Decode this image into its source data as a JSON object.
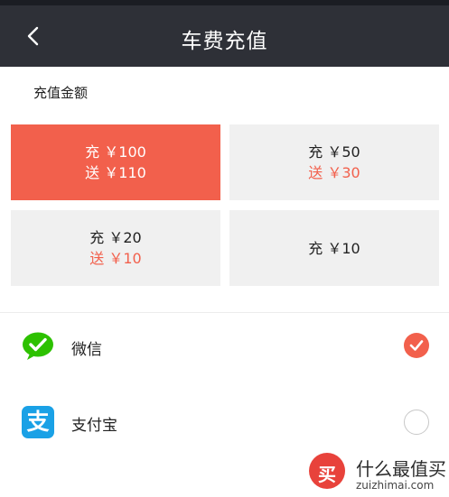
{
  "header": {
    "title": "车费充值",
    "back_icon": "chevron-left-icon"
  },
  "amount_section": {
    "label": "充值金额",
    "options": [
      {
        "charge": "充 ￥100",
        "bonus": "送 ￥110",
        "selected": true
      },
      {
        "charge": "充 ￥50",
        "bonus": "送 ￥30",
        "selected": false
      },
      {
        "charge": "充 ￥20",
        "bonus": "送 ￥10",
        "selected": false
      },
      {
        "charge": "充 ￥10",
        "bonus": "",
        "selected": false
      }
    ]
  },
  "payment_methods": [
    {
      "label": "微信",
      "icon": "wechat-icon",
      "checked": true
    },
    {
      "label": "支付宝",
      "icon": "alipay-icon",
      "checked": false
    }
  ],
  "watermark": {
    "brand": "什么最值买",
    "domain": "zuizhimai.com",
    "logo_glyph": "买"
  },
  "colors": {
    "accent": "#f2604c",
    "navbar": "#2e3037",
    "wechat": "#2dc100",
    "alipay": "#1aa1e6"
  }
}
